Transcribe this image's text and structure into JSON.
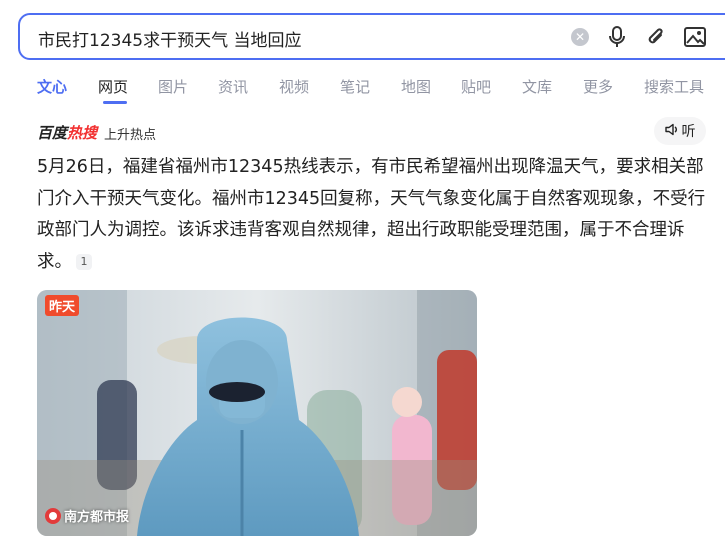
{
  "search": {
    "query": "市民打12345求干预天气 当地回应"
  },
  "tabs": [
    {
      "label": "文心"
    },
    {
      "label": "网页"
    },
    {
      "label": "图片"
    },
    {
      "label": "资讯"
    },
    {
      "label": "视频"
    },
    {
      "label": "笔记"
    },
    {
      "label": "地图"
    },
    {
      "label": "贴吧"
    },
    {
      "label": "文库"
    },
    {
      "label": "更多"
    },
    {
      "label": "搜索工具"
    }
  ],
  "source": {
    "logo_text_1": "百度",
    "logo_text_2": "热搜",
    "subtitle": "上升热点",
    "listen_label": "听"
  },
  "summary": {
    "lines": [
      "5月26日，福建省福州市12345热线表示，有市民希望福州出现降温天气，要求相关部",
      "门介入干预天气变化。福州市12345回复称，天气气象变化属于自然客观现象，不受行",
      "政部门人为调控。该诉求违背客观自然规律，超出行政职能受理范围，属于不合理诉",
      "求。"
    ],
    "citation": "1"
  },
  "image_card": {
    "date_badge": "昨天",
    "source_label": "南方都市报"
  },
  "colors": {
    "accent": "#4e6ef2",
    "hot": "#f23030",
    "badge": "#f04b2c"
  }
}
